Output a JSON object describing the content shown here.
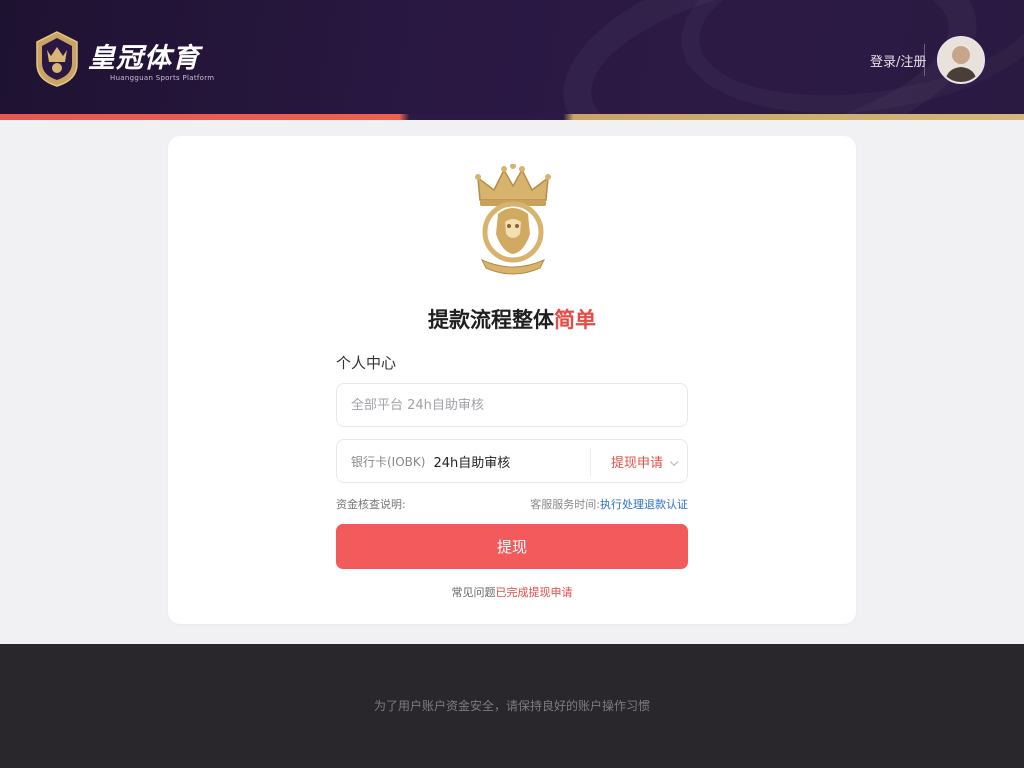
{
  "header": {
    "brand_name": "皇冠体育",
    "brand_subtitle": "Huangguan Sports Platform",
    "login_label": "登录/注册"
  },
  "card": {
    "headline_main": "提款流程整体",
    "headline_highlight": "简单",
    "section_label": "个人中心",
    "field1": {
      "placeholder": "全部平台 24h自助审核",
      "value": ""
    },
    "field2": {
      "prefix": "银行卡(IOBK)",
      "value": "24h自助审核",
      "apply_label": "提现申请"
    },
    "hint_left": "资金核查说明:",
    "hint_right_text": "客服服务时间:",
    "hint_right_link": "执行处理退款认证",
    "submit_label": "提现",
    "bottom_note_text": "常见问题",
    "bottom_note_link": "已完成提现申请"
  },
  "footer": {
    "text": "为了用户账户资金安全，请保持良好的账户操作习惯"
  },
  "colors": {
    "header_bg": "#2a1843",
    "accent_red": "#f35a5b",
    "accent_gold": "#c9a463",
    "link_blue": "#2c6fc7",
    "footer_bg": "#29272b"
  }
}
